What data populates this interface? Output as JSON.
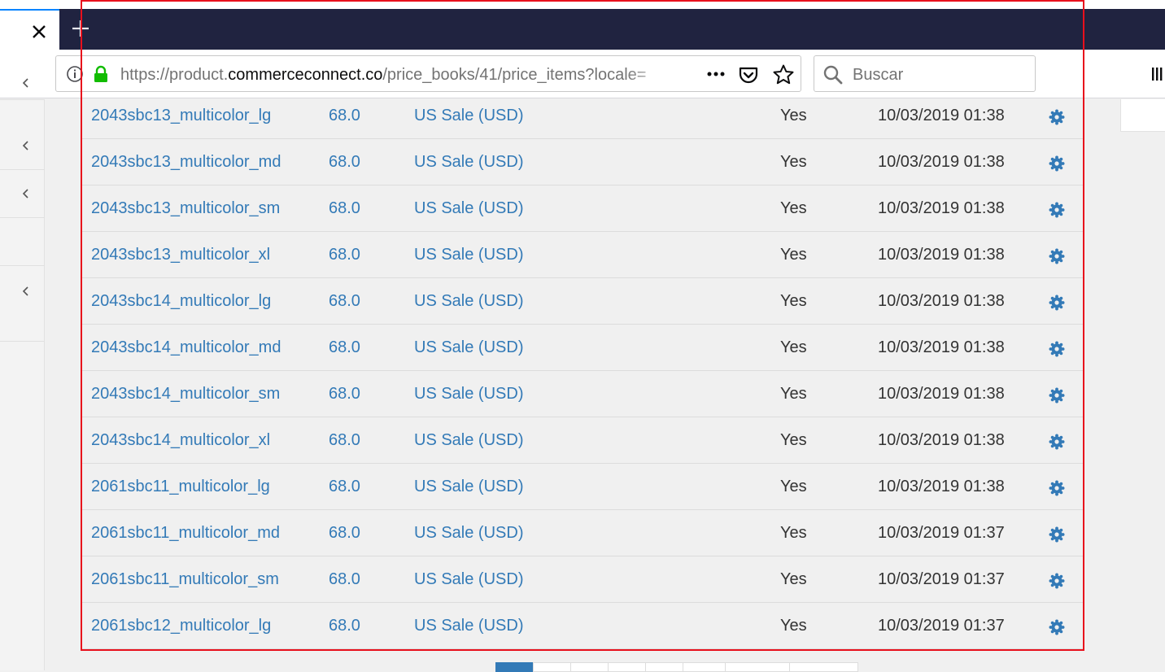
{
  "browser": {
    "url_prefix": "https://product.",
    "url_domain": "commerceconnect.co",
    "url_path": "/price_books/41/price_items?locale=",
    "search_placeholder": "Buscar"
  },
  "colors": {
    "link": "#337ab7",
    "text": "#333333",
    "highlight_border": "#e8101c",
    "tab_dark": "#202340"
  },
  "table": {
    "rows": [
      {
        "sku": "2043sbc13_multicolor_lg",
        "price": "68.0",
        "book": "US Sale (USD)",
        "active": "Yes",
        "date": "10/03/2019 01:38"
      },
      {
        "sku": "2043sbc13_multicolor_md",
        "price": "68.0",
        "book": "US Sale (USD)",
        "active": "Yes",
        "date": "10/03/2019 01:38"
      },
      {
        "sku": "2043sbc13_multicolor_sm",
        "price": "68.0",
        "book": "US Sale (USD)",
        "active": "Yes",
        "date": "10/03/2019 01:38"
      },
      {
        "sku": "2043sbc13_multicolor_xl",
        "price": "68.0",
        "book": "US Sale (USD)",
        "active": "Yes",
        "date": "10/03/2019 01:38"
      },
      {
        "sku": "2043sbc14_multicolor_lg",
        "price": "68.0",
        "book": "US Sale (USD)",
        "active": "Yes",
        "date": "10/03/2019 01:38"
      },
      {
        "sku": "2043sbc14_multicolor_md",
        "price": "68.0",
        "book": "US Sale (USD)",
        "active": "Yes",
        "date": "10/03/2019 01:38"
      },
      {
        "sku": "2043sbc14_multicolor_sm",
        "price": "68.0",
        "book": "US Sale (USD)",
        "active": "Yes",
        "date": "10/03/2019 01:38"
      },
      {
        "sku": "2043sbc14_multicolor_xl",
        "price": "68.0",
        "book": "US Sale (USD)",
        "active": "Yes",
        "date": "10/03/2019 01:38"
      },
      {
        "sku": "2061sbc11_multicolor_lg",
        "price": "68.0",
        "book": "US Sale (USD)",
        "active": "Yes",
        "date": "10/03/2019 01:38"
      },
      {
        "sku": "2061sbc11_multicolor_md",
        "price": "68.0",
        "book": "US Sale (USD)",
        "active": "Yes",
        "date": "10/03/2019 01:37"
      },
      {
        "sku": "2061sbc11_multicolor_sm",
        "price": "68.0",
        "book": "US Sale (USD)",
        "active": "Yes",
        "date": "10/03/2019 01:37"
      },
      {
        "sku": "2061sbc12_multicolor_lg",
        "price": "68.0",
        "book": "US Sale (USD)",
        "active": "Yes",
        "date": "10/03/2019 01:37"
      }
    ]
  },
  "icons": {
    "row_action": "gear-icon",
    "sidebar_expand": "chevron-left-icon"
  }
}
